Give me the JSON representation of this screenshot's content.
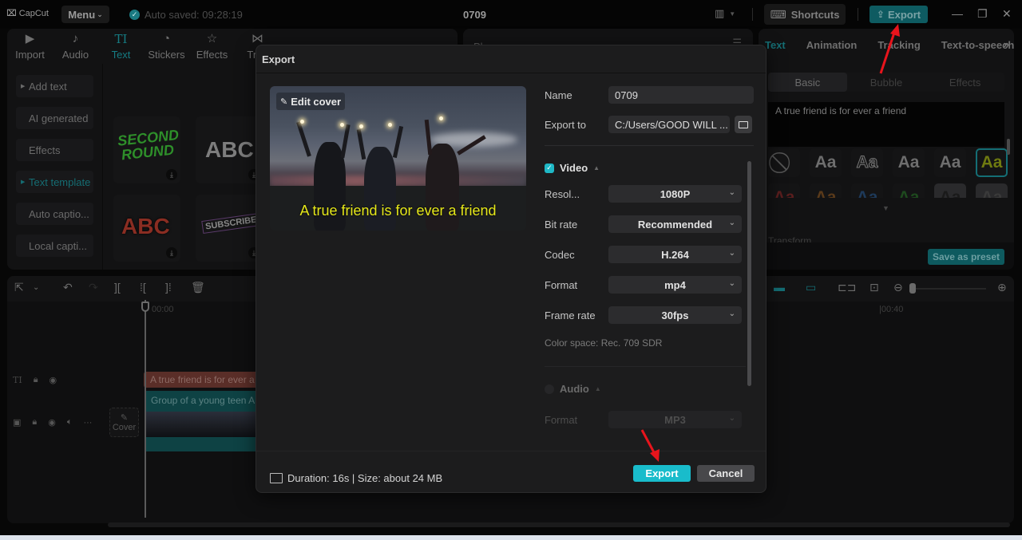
{
  "titlebar": {
    "app_name": "CapCut",
    "menu_label": "Menu",
    "autosave_text": "Auto saved: 09:28:19",
    "project_title": "0709",
    "shortcuts_label": "Shortcuts",
    "export_label": "Export"
  },
  "toolbar": {
    "tabs": [
      {
        "label": "Import",
        "icon": "import-icon"
      },
      {
        "label": "Audio",
        "icon": "audio-icon"
      },
      {
        "label": "Text",
        "icon": "text-icon",
        "active": true
      },
      {
        "label": "Stickers",
        "icon": "stickers-icon"
      },
      {
        "label": "Effects",
        "icon": "effects-icon"
      },
      {
        "label": "Tran",
        "icon": "transitions-icon"
      },
      {
        "label": "",
        "icon": "captions-icon"
      },
      {
        "label": "",
        "icon": "filters-icon"
      },
      {
        "label": "",
        "icon": "adjustment-icon"
      }
    ]
  },
  "text_sidebar": {
    "items": [
      {
        "label": "Add text",
        "expandable": true
      },
      {
        "label": "AI generated"
      },
      {
        "label": "Effects"
      },
      {
        "label": "Text template",
        "expandable": true,
        "active": true
      },
      {
        "label": "Auto captio..."
      },
      {
        "label": "Local capti..."
      }
    ]
  },
  "templates": {
    "items": [
      "SECOND ROUND",
      "ABC",
      "ABC",
      "SUBSCRIBE"
    ]
  },
  "player": {
    "label": "Player"
  },
  "right_panel": {
    "tabs": [
      "Text",
      "Animation",
      "Tracking",
      "Text-to-speech"
    ],
    "active_tab": "Text",
    "subtabs": [
      "Basic",
      "Bubble",
      "Effects"
    ],
    "active_subtab": "Basic",
    "text_value": "A true friend is for ever a friend",
    "style_chip_label": "Aa",
    "transform_label": "Transform",
    "save_preset_label": "Save as preset"
  },
  "timeline": {
    "start_time": "00:00",
    "mark_time": "|00:40",
    "text_clip_label": "A true friend is for ever a friend",
    "video_clip_label": "Group of a young teen A",
    "cover_label": "Cover"
  },
  "export_dialog": {
    "title": "Export",
    "edit_cover_label": "Edit cover",
    "cover_caption": "A true friend is for ever a friend",
    "name_label": "Name",
    "name_value": "0709",
    "export_to_label": "Export to",
    "export_to_value": "C:/Users/GOOD WILL ...",
    "video_section": {
      "label": "Video",
      "checked": true,
      "fields": [
        {
          "label": "Resol...",
          "value": "1080P"
        },
        {
          "label": "Bit rate",
          "value": "Recommended"
        },
        {
          "label": "Codec",
          "value": "H.264"
        },
        {
          "label": "Format",
          "value": "mp4"
        },
        {
          "label": "Frame rate",
          "value": "30fps"
        }
      ],
      "color_space": "Color space: Rec. 709 SDR"
    },
    "audio_section": {
      "label": "Audio",
      "checked": false,
      "format_label": "Format",
      "format_value": "MP3"
    },
    "duration_text": "Duration: 16s | Size: about 24 MB",
    "export_button": "Export",
    "cancel_button": "Cancel"
  },
  "colors": {
    "accent": "#19bccb",
    "caption_yellow": "#e6e81a",
    "annotation_red": "#e8141c"
  }
}
